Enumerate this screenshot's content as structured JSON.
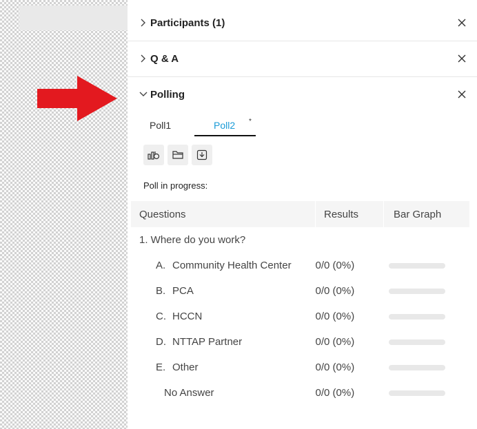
{
  "sections": {
    "participants": {
      "title": "Participants (1)"
    },
    "qa": {
      "title": "Q & A"
    },
    "polling": {
      "title": "Polling"
    }
  },
  "tabs": [
    {
      "label": "Poll1",
      "active": false
    },
    {
      "label": "Poll2",
      "active": true,
      "star": "*"
    }
  ],
  "toolbar": {
    "icons": [
      "poll-results-icon",
      "folder-icon",
      "download-icon"
    ]
  },
  "poll": {
    "status": "Poll in progress:",
    "headers": {
      "questions": "Questions",
      "results": "Results",
      "bar_graph": "Bar Graph"
    },
    "question": "1. Where do you work?",
    "options": [
      {
        "letter": "A.",
        "text": "Community Health Center",
        "result": "0/0 (0%)",
        "fraction": 0
      },
      {
        "letter": "B.",
        "text": "PCA",
        "result": "0/0 (0%)",
        "fraction": 0
      },
      {
        "letter": "C.",
        "text": "HCCN",
        "result": "0/0 (0%)",
        "fraction": 0
      },
      {
        "letter": "D.",
        "text": "NTTAP Partner",
        "result": "0/0 (0%)",
        "fraction": 0
      },
      {
        "letter": "E.",
        "text": "Other",
        "result": "0/0 (0%)",
        "fraction": 0
      },
      {
        "letter": "",
        "text": "No Answer",
        "result": "0/0 (0%)",
        "fraction": 0
      }
    ]
  },
  "colors": {
    "accent": "#1a9bd7",
    "arrow": "#e3191f"
  }
}
